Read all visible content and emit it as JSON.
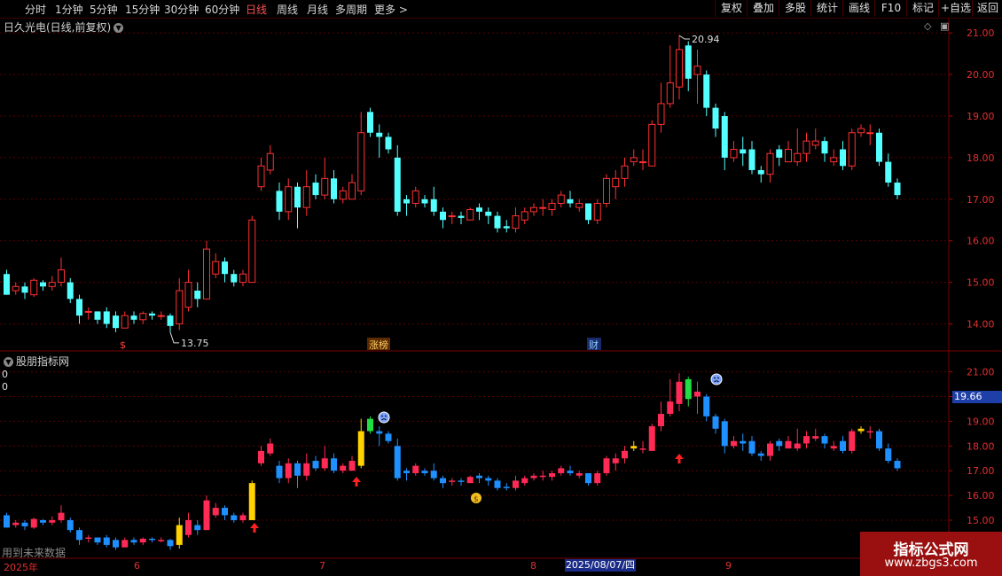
{
  "toolbar": {
    "periods": [
      {
        "label": "分时",
        "active": false
      },
      {
        "label": "1分钟",
        "active": false
      },
      {
        "label": "5分钟",
        "active": false
      },
      {
        "label": "15分钟",
        "active": false
      },
      {
        "label": "30分钟",
        "active": false
      },
      {
        "label": "60分钟",
        "active": false
      },
      {
        "label": "日线",
        "active": true
      },
      {
        "label": "周线",
        "active": false
      },
      {
        "label": "月线",
        "active": false
      },
      {
        "label": "多周期",
        "active": false
      },
      {
        "label": "更多 >",
        "active": false
      }
    ],
    "buttons": [
      "复权",
      "叠加",
      "多股",
      "统计",
      "画线",
      "F10",
      "标记",
      "+自选",
      "返回"
    ]
  },
  "price_panel": {
    "title": "日久光电(日线,前复权)",
    "high_label": "20.94",
    "low_label": "13.75",
    "marker_s": "$",
    "marker_zhangbang": "涨榜",
    "marker_cai": "财"
  },
  "indicator_panel": {
    "title": "股朋指标网",
    "zero_a": "0",
    "zero_b": "0",
    "future_note": "用到未来数据",
    "current_price": "19.66"
  },
  "date_axis": {
    "labels": [
      "2025年",
      "6",
      "7",
      "8",
      "9"
    ],
    "cursor_date": "2025/08/07/四"
  },
  "watermark": {
    "title": "指标公式网",
    "url": "www.zbgs3.com"
  },
  "colors": {
    "up": "#ff3030",
    "down": "#54ffff",
    "grid": "#5a0000",
    "axis_text": "#e03030",
    "ind_up": "#ff2a55",
    "ind_down": "#1e90ff",
    "ind_flat": "#ffd200"
  },
  "chart_data": {
    "type": "candlestick",
    "price_axis_ticks": [
      14.0,
      15.0,
      16.0,
      17.0,
      18.0,
      19.0,
      20.0,
      21.0
    ],
    "indicator_axis_ticks": [
      15.0,
      16.0,
      17.0,
      18.0,
      19.0,
      20.0,
      21.0
    ],
    "ylim": [
      13.5,
      21.3
    ],
    "candles": [
      [
        15.2,
        14.7,
        15.3,
        14.7
      ],
      [
        14.8,
        14.9,
        15.0,
        14.7
      ],
      [
        14.9,
        14.75,
        15.0,
        14.6
      ],
      [
        14.7,
        15.05,
        15.1,
        14.65
      ],
      [
        15.0,
        14.9,
        15.05,
        14.8
      ],
      [
        14.9,
        15.0,
        15.15,
        14.8
      ],
      [
        15.0,
        15.3,
        15.6,
        14.9
      ],
      [
        15.0,
        14.6,
        15.1,
        14.5
      ],
      [
        14.6,
        14.2,
        14.7,
        14.0
      ],
      [
        14.3,
        14.3,
        14.4,
        14.1
      ],
      [
        14.3,
        14.1,
        14.3,
        14.0
      ],
      [
        14.3,
        14.0,
        14.4,
        13.9
      ],
      [
        14.2,
        13.9,
        14.3,
        13.8
      ],
      [
        13.9,
        14.2,
        14.3,
        13.9
      ],
      [
        14.2,
        14.1,
        14.3,
        14.0
      ],
      [
        14.1,
        14.25,
        14.3,
        14.0
      ],
      [
        14.25,
        14.2,
        14.3,
        14.1
      ],
      [
        14.2,
        14.2,
        14.3,
        14.1
      ],
      [
        14.2,
        13.95,
        14.25,
        13.8
      ],
      [
        14.0,
        14.8,
        15.1,
        13.85
      ],
      [
        14.4,
        15.0,
        15.3,
        14.3
      ],
      [
        14.8,
        14.6,
        15.0,
        14.4
      ],
      [
        14.6,
        15.8,
        16.0,
        14.6
      ],
      [
        15.2,
        15.5,
        15.7,
        15.1
      ],
      [
        15.5,
        15.2,
        15.6,
        15.0
      ],
      [
        15.2,
        15.0,
        15.3,
        14.9
      ],
      [
        15.0,
        15.2,
        15.3,
        14.9
      ],
      [
        15.0,
        16.5,
        16.6,
        15.0
      ],
      [
        17.3,
        17.8,
        18.0,
        17.2
      ],
      [
        17.7,
        18.1,
        18.3,
        17.6
      ],
      [
        17.2,
        16.7,
        17.4,
        16.5
      ],
      [
        16.7,
        17.3,
        17.5,
        16.5
      ],
      [
        17.3,
        16.8,
        17.4,
        16.3
      ],
      [
        16.8,
        17.3,
        17.7,
        16.6
      ],
      [
        17.4,
        17.1,
        17.6,
        17.0
      ],
      [
        17.1,
        17.5,
        18.0,
        17.0
      ],
      [
        17.5,
        17.0,
        17.7,
        16.9
      ],
      [
        17.0,
        17.2,
        17.3,
        16.9
      ],
      [
        17.0,
        17.4,
        17.6,
        17.0
      ],
      [
        17.2,
        18.6,
        19.1,
        17.1
      ],
      [
        19.1,
        18.6,
        19.2,
        18.5
      ],
      [
        18.6,
        18.5,
        18.8,
        18.0
      ],
      [
        18.5,
        18.2,
        18.6,
        18.1
      ],
      [
        18.0,
        16.7,
        18.3,
        16.6
      ],
      [
        17.0,
        16.9,
        17.1,
        16.6
      ],
      [
        16.9,
        17.2,
        17.3,
        16.8
      ],
      [
        17.0,
        16.9,
        17.1,
        16.8
      ],
      [
        17.0,
        16.7,
        17.3,
        16.6
      ],
      [
        16.7,
        16.5,
        16.8,
        16.3
      ],
      [
        16.6,
        16.6,
        16.7,
        16.4
      ],
      [
        16.6,
        16.55,
        16.7,
        16.4
      ],
      [
        16.5,
        16.75,
        16.8,
        16.5
      ],
      [
        16.8,
        16.7,
        16.9,
        16.5
      ],
      [
        16.7,
        16.6,
        16.8,
        16.4
      ],
      [
        16.6,
        16.3,
        16.7,
        16.2
      ],
      [
        16.35,
        16.3,
        16.5,
        16.2
      ],
      [
        16.3,
        16.6,
        16.8,
        16.2
      ],
      [
        16.5,
        16.7,
        16.8,
        16.4
      ],
      [
        16.7,
        16.8,
        16.9,
        16.6
      ],
      [
        16.8,
        16.8,
        17.0,
        16.6
      ],
      [
        16.75,
        16.9,
        17.0,
        16.6
      ],
      [
        16.9,
        17.1,
        17.2,
        16.8
      ],
      [
        17.0,
        16.9,
        17.2,
        16.8
      ],
      [
        16.8,
        16.9,
        17.0,
        16.7
      ],
      [
        16.9,
        16.5,
        16.9,
        16.4
      ],
      [
        16.5,
        16.9,
        17.0,
        16.4
      ],
      [
        16.9,
        17.5,
        17.6,
        16.8
      ],
      [
        17.3,
        17.5,
        17.7,
        17.0
      ],
      [
        17.5,
        17.8,
        18.0,
        17.3
      ],
      [
        17.9,
        18.0,
        18.2,
        17.8
      ],
      [
        17.9,
        17.9,
        18.2,
        17.7
      ],
      [
        17.8,
        18.8,
        18.9,
        17.8
      ],
      [
        18.8,
        19.3,
        19.8,
        18.6
      ],
      [
        19.3,
        19.8,
        20.7,
        19.2
      ],
      [
        19.7,
        20.6,
        20.94,
        19.4
      ],
      [
        20.7,
        19.9,
        20.8,
        19.6
      ],
      [
        20.0,
        20.2,
        20.6,
        19.3
      ],
      [
        20.0,
        19.2,
        20.1,
        19.0
      ],
      [
        19.2,
        18.7,
        19.3,
        18.5
      ],
      [
        19.0,
        18.0,
        19.1,
        17.7
      ],
      [
        18.0,
        18.2,
        18.4,
        17.9
      ],
      [
        18.2,
        18.1,
        18.5,
        17.8
      ],
      [
        18.2,
        17.7,
        18.4,
        17.6
      ],
      [
        17.7,
        17.6,
        17.8,
        17.4
      ],
      [
        17.6,
        18.1,
        18.2,
        17.4
      ],
      [
        18.2,
        18.0,
        18.3,
        17.8
      ],
      [
        17.9,
        18.2,
        18.4,
        17.9
      ],
      [
        17.9,
        18.1,
        18.7,
        17.8
      ],
      [
        18.1,
        18.4,
        18.6,
        17.9
      ],
      [
        18.3,
        18.4,
        18.7,
        18.2
      ],
      [
        18.4,
        18.1,
        18.5,
        17.9
      ],
      [
        17.9,
        18.0,
        18.2,
        17.8
      ],
      [
        18.2,
        17.8,
        18.4,
        17.7
      ],
      [
        17.8,
        18.6,
        18.7,
        17.7
      ],
      [
        18.6,
        18.7,
        18.8,
        18.5
      ],
      [
        18.6,
        18.6,
        18.8,
        18.3
      ],
      [
        18.6,
        17.9,
        18.7,
        17.8
      ],
      [
        17.9,
        17.4,
        18.1,
        17.3
      ],
      [
        17.4,
        17.1,
        17.5,
        17.0
      ]
    ]
  }
}
